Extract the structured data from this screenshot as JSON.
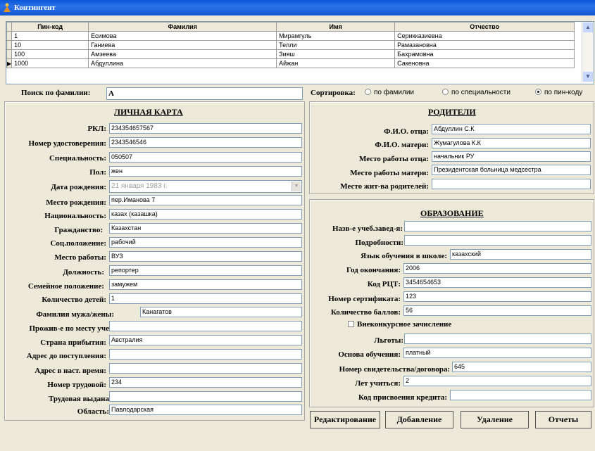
{
  "window": {
    "title": "Контингент"
  },
  "grid": {
    "columns": [
      "Пин-код",
      "Фамилия",
      "Имя",
      "Отчество"
    ],
    "rows": [
      [
        "1",
        "Есимова",
        "Мирамгуль",
        "Серикказиевна"
      ],
      [
        "10",
        "Ганиева",
        "Телли",
        "Рамазановна"
      ],
      [
        "100",
        "Амзеева",
        "Зияш",
        "Бахрамовна"
      ],
      [
        "1000",
        "Абдуллина",
        "Айжан",
        "Сакеновна"
      ]
    ],
    "current_row_marker": "▶"
  },
  "search": {
    "label": "Поиск по фамилии:",
    "value": "А"
  },
  "sort": {
    "label": "Сортировка:",
    "options": [
      "по фамилии",
      "по специальности",
      "по пин-коду"
    ],
    "selected": 2
  },
  "personal": {
    "header": "ЛИЧНАЯ КАРТА",
    "fields": [
      {
        "label": "РКЛ:",
        "value": "234354657567"
      },
      {
        "label": "Номер удостоверения:",
        "value": "2343546546"
      },
      {
        "label": "Специальность:",
        "value": "050507"
      },
      {
        "label": "Пол:",
        "value": "жен"
      },
      {
        "label": "Дата рождения:",
        "value": "21  января  1983 г."
      },
      {
        "label": "Место рождения:",
        "value": "пер.Иманова 7"
      },
      {
        "label": "Национальность:",
        "value": "казах (казашка)"
      },
      {
        "label": "Гражданство:",
        "value": "Казахстан"
      },
      {
        "label": "Соц.положение:",
        "value": "рабочий"
      },
      {
        "label": "Место работы:",
        "value": "ВУЗ"
      },
      {
        "label": "Должность:",
        "value": "репортер"
      },
      {
        "label": "Семейное положение:",
        "value": "замужем"
      },
      {
        "label": "Количество детей:",
        "value": "1"
      },
      {
        "label": "Фамилия мужа/жены:",
        "value": "Канагатов"
      },
      {
        "label": "Прожив-е по месту уче",
        "value": ""
      },
      {
        "label": "Страна прибытия:",
        "value": "Австралия"
      },
      {
        "label": "Адрес до поступления:",
        "value": ""
      },
      {
        "label": "Адрес в наст. время:",
        "value": ""
      },
      {
        "label": "Номер трудовой:",
        "value": "234"
      },
      {
        "label": "Трудовая выдана",
        "value": ""
      },
      {
        "label": "Область:",
        "value": "Павлодарская"
      }
    ]
  },
  "parents": {
    "header": "РОДИТЕЛИ",
    "fields": [
      {
        "label": "Ф.И.О. отца:",
        "value": "Абдуллин С.К"
      },
      {
        "label": "Ф.И.О. матери:",
        "value": "Жумагулова К.К"
      },
      {
        "label": "Место работы отца:",
        "value": " начальник РУ"
      },
      {
        "label": "Место работы матери:",
        "value": "Президентская больница  медсестра"
      },
      {
        "label": "Место жит-ва родителей:",
        "value": ""
      }
    ]
  },
  "education": {
    "header": "ОБРАЗОВАНИЕ",
    "fields": [
      {
        "label": "Назв-е учеб.завед-я:",
        "value": ""
      },
      {
        "label": "Подробности:",
        "value": ""
      },
      {
        "label": "Язык обучения в школе:",
        "value": "казахский"
      },
      {
        "label": "Год окончания:",
        "value": "2006"
      },
      {
        "label": "Код РЦТ:",
        "value": "3454654653"
      },
      {
        "label": "Номер сертификата:",
        "value": "123"
      },
      {
        "label": "Количество баллов:",
        "value": "56"
      },
      {
        "label": "Внеконкурсное зачисление",
        "value": ""
      },
      {
        "label": "Льготы:",
        "value": ""
      },
      {
        "label": "Основа обучения:",
        "value": "платный"
      },
      {
        "label": "Номер свидетельства/договора:",
        "value": "645"
      },
      {
        "label": "Лет учиться:",
        "value": "2"
      },
      {
        "label": "Код присвоения кредита:",
        "value": ""
      }
    ]
  },
  "buttons": {
    "edit": "Редактирование",
    "add": "Добавление",
    "delete": "Удаление",
    "reports": "Отчеты"
  },
  "icons": {
    "app": "app-icon",
    "scroll_up": "scroll-up-icon",
    "scroll_down": "scroll-down-icon",
    "dropdown": "chevron-down-icon"
  }
}
